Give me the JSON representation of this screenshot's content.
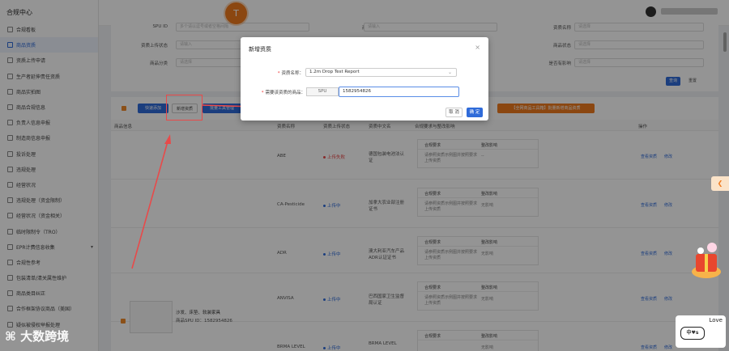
{
  "app": {
    "title": "合规中心"
  },
  "sidebar": {
    "items": [
      {
        "label": "合规看板",
        "active": false
      },
      {
        "label": "商品资质",
        "active": true
      },
      {
        "label": "资质上传申请",
        "active": false
      },
      {
        "label": "生产者延伸责任资质",
        "active": false
      },
      {
        "label": "商品实拍图",
        "active": false
      },
      {
        "label": "商品合规信息",
        "active": false
      },
      {
        "label": "负责人信息申报",
        "active": false
      },
      {
        "label": "制造商信息申报",
        "active": false
      },
      {
        "label": "投诉处理",
        "active": false
      },
      {
        "label": "违规处理",
        "active": false
      },
      {
        "label": "经营状况",
        "active": false
      },
      {
        "label": "违规处理（资金限制）",
        "active": false
      },
      {
        "label": "经营状况（资金相关）",
        "active": false
      },
      {
        "label": "临时限制令（TRO）",
        "active": false
      },
      {
        "label": "EPR计费信息收集",
        "active": false,
        "caret": true
      },
      {
        "label": "合规性参考",
        "active": false
      },
      {
        "label": "包装清单/清关属性维护",
        "active": false
      },
      {
        "label": "商品类目纠正",
        "active": false
      },
      {
        "label": "合作框架协议商品（美国）",
        "active": false
      },
      {
        "label": "疑似被侵权举报处理",
        "active": false
      }
    ]
  },
  "filters": {
    "spu_label": "SPU ID",
    "spu_placeholder": "多个请以逗号或者空格间隔",
    "product_name_label": "商品名称",
    "product_name_placeholder": "请输入",
    "qual_name_label": "资质名称",
    "qual_name_placeholder": "请选择",
    "upload_status_label": "资质上传状态",
    "upload_status_placeholder": "请输入",
    "product_status_label": "商品状态",
    "product_status_placeholder": "请选择",
    "product_class_label": "商品分类",
    "product_class_placeholder": "请选择",
    "impact_label": "是否有影响",
    "impact_placeholder": "请选择",
    "query_btn": "查询",
    "reset_btn": "重置"
  },
  "actions": {
    "batch_upload": "快速添加",
    "add_qualification": "新增资质",
    "batch_tool": "批量工具管理",
    "batch_add_products": "【全网商品工具箱】批量新增商品资质"
  },
  "table": {
    "headers": [
      "商品信息",
      "资质名称",
      "资质上传状态",
      "资质中文名",
      "合规要求与整改影响",
      "操作"
    ],
    "sub_headers": [
      "合规要求",
      "整改影响"
    ],
    "rows": [
      {
        "qual": "ABE",
        "status": "上传失败",
        "status_color": "#e84a4a",
        "cn": "德国包装电池法认证",
        "req": "请参照资质示例图并按照要求上传资质",
        "impact": "--",
        "op1": "查看资质",
        "op2": "修改"
      },
      {
        "qual": "CA-Pesticide",
        "status": "上传中",
        "status_color": "#2f6bd9",
        "cn": "加拿大农业部注册证书",
        "req": "请参照资质示例图并按照要求上传资质",
        "impact": "无影响",
        "op1": "查看资质",
        "op2": "修改"
      },
      {
        "qual": "ADR",
        "status": "上传中",
        "status_color": "#2f6bd9",
        "cn": "澳大利亚汽车产品ADR认证证书",
        "req": "请参照资质示例图并按照要求上传资质",
        "impact": "无影响",
        "op1": "查看资质",
        "op2": "修改"
      },
      {
        "qual": "ANVISA",
        "status": "上传中",
        "status_color": "#2f6bd9",
        "cn": "巴西国家卫生监督局认证",
        "req": "请参照资质示例图并按照要求上传资质",
        "impact": "无影响",
        "op1": "查看资质",
        "op2": "修改"
      },
      {
        "qual": "BRMA LEVEL",
        "status": "上传中",
        "status_color": "#2f6bd9",
        "cn": "BRMA LEVEL",
        "req": "",
        "impact": "无影响",
        "op1": "查看资质",
        "op2": "修改"
      }
    ],
    "product": {
      "name": "沙发、床垫、软装家具",
      "spu": "商品SPU ID：1582954826"
    }
  },
  "modal": {
    "title": "新增资质",
    "qual_label": "资质名称：",
    "qual_value": "1.2m Drop Test Report",
    "product_label": "需要该资质的商品：",
    "spu_tag": "SPU",
    "spu_value": "1582954826",
    "cancel": "取 消",
    "ok": "确 定"
  },
  "watermark": "大数跨境",
  "badge_text": "T",
  "love_text": "Love",
  "love_box": "中♥s",
  "colors": {
    "primary": "#2f6bd9",
    "orange": "#f07a1e",
    "annotation_red": "#e84a4a"
  }
}
